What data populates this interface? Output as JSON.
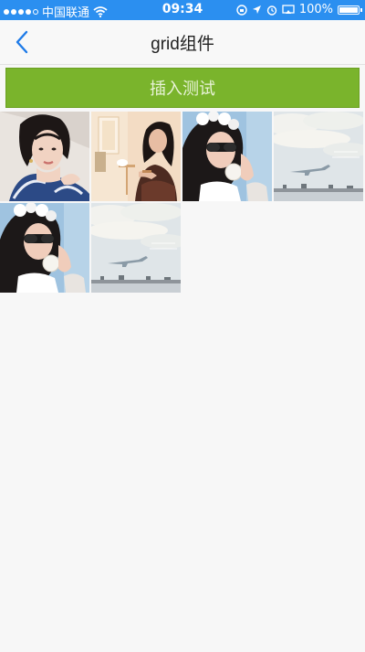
{
  "status_bar": {
    "carrier": "中国联通",
    "time": "09:34",
    "battery_percent": "100%",
    "battery_level": 1.0
  },
  "nav": {
    "title": "grid组件",
    "back_icon": "chevron-left-icon"
  },
  "insert_button": {
    "label": "插入测试"
  },
  "grid": {
    "photos": [
      {
        "kind": "portrait-woman-blue"
      },
      {
        "kind": "woman-seated-interior"
      },
      {
        "kind": "woman-sunglasses-drink"
      },
      {
        "kind": "sky-airplane"
      },
      {
        "kind": "woman-sunglasses-drink"
      },
      {
        "kind": "sky-airplane"
      }
    ]
  },
  "colors": {
    "status_bar": "#2b8ff0",
    "nav_back": "#1e7be8",
    "button_bg": "#7ab42c",
    "page_bg": "#f7f7f7"
  }
}
